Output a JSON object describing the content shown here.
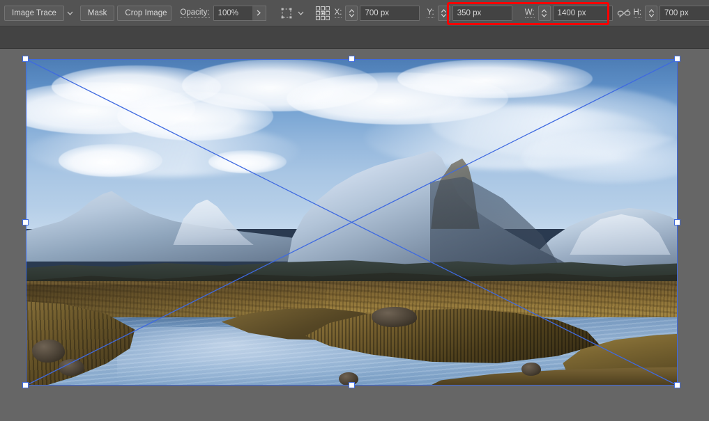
{
  "app": {
    "name": "Illustrator Control Bar",
    "accent_blue": "#3f6ae0",
    "highlight_red": "#ff0000",
    "bar_bg": "#535353",
    "canvas_bg": "#666666"
  },
  "control_bar": {
    "image_trace": {
      "label": "Image Trace",
      "dropdown_icon": "chevron-down-icon"
    },
    "mask": {
      "label": "Mask"
    },
    "crop_image": {
      "label": "Crop Image"
    },
    "opacity": {
      "label": "Opacity:",
      "value": "100%",
      "expand_icon": "chevron-right-icon"
    },
    "transform_tool": {
      "icon": "bounding-box-icon",
      "dropdown_icon": "chevron-down-icon"
    },
    "reference_point": {
      "icon": "reference-point-grid-icon",
      "selected_anchor": "center"
    },
    "x": {
      "label": "X:",
      "value": "700 px",
      "stepper_icon": "stepper-updown-icon"
    },
    "y": {
      "label": "Y:",
      "value": "350 px",
      "stepper_icon": "stepper-updown-icon"
    },
    "w": {
      "label": "W:",
      "value": "1400 px",
      "stepper_icon": "stepper-updown-icon"
    },
    "h": {
      "label": "H:",
      "value": "700 px",
      "stepper_icon": "stepper-updown-icon"
    },
    "constrain_proportions": {
      "icon": "broken-chain-link-icon",
      "state": "unlinked"
    },
    "align_transform": {
      "icon": "transform-fit-icon"
    },
    "highlight_annotation": {
      "target": "width-height-fields",
      "color": "#ff0000"
    }
  },
  "canvas": {
    "placed_image": {
      "name": "mountain-loch-landscape",
      "description": "Snow-capped mountain range over golden moorland with a winding river",
      "selected": true,
      "handles": [
        "top-left",
        "top-center",
        "top-right",
        "mid-left",
        "mid-right",
        "bottom-left",
        "bottom-center",
        "bottom-right"
      ],
      "diagonals_visible": true
    }
  }
}
